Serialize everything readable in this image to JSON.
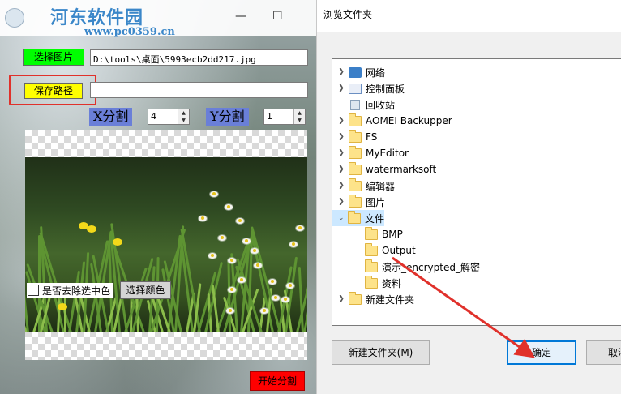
{
  "app": {
    "watermark_logo": "河东软件园",
    "watermark_url": "www.pc0359.cn",
    "select_image_label": "选择图片",
    "image_path": "D:\\tools\\桌面\\5993ecb2dd217.jpg",
    "save_path_label": "保存路径",
    "save_path": "",
    "x_split_label": "X分割",
    "x_split_value": "4",
    "y_split_label": "Y分割",
    "y_split_value": "1",
    "remove_color_label": "是否去除选中色",
    "select_color_label": "选择颜色",
    "start_split_label": "开始分割"
  },
  "dialog": {
    "title": "浏览文件夹",
    "tree": [
      {
        "label": "网络",
        "icon": "network-icon",
        "expander": "right",
        "level": 0
      },
      {
        "label": "控制面板",
        "icon": "control-panel-icon",
        "expander": "right",
        "level": 0
      },
      {
        "label": "回收站",
        "icon": "recycle-bin-icon",
        "expander": "none",
        "level": 0
      },
      {
        "label": "AOMEI Backupper",
        "icon": "folder-icon",
        "expander": "right",
        "level": 0
      },
      {
        "label": "FS",
        "icon": "folder-icon",
        "expander": "right",
        "level": 0
      },
      {
        "label": "MyEditor",
        "icon": "folder-icon",
        "expander": "right",
        "level": 0
      },
      {
        "label": "watermarksoft",
        "icon": "folder-icon",
        "expander": "right",
        "level": 0
      },
      {
        "label": "编辑器",
        "icon": "folder-icon",
        "expander": "right",
        "level": 0
      },
      {
        "label": "图片",
        "icon": "folder-icon",
        "expander": "right",
        "level": 0
      },
      {
        "label": "文件",
        "icon": "folder-icon",
        "expander": "down",
        "level": 0,
        "selected": true
      },
      {
        "label": "BMP",
        "icon": "folder-icon",
        "expander": "none",
        "level": 1
      },
      {
        "label": "Output",
        "icon": "folder-icon",
        "expander": "none",
        "level": 1
      },
      {
        "label": "演示_encrypted_解密",
        "icon": "folder-icon",
        "expander": "none",
        "level": 1
      },
      {
        "label": "资料",
        "icon": "folder-icon",
        "expander": "none",
        "level": 1
      },
      {
        "label": "新建文件夹",
        "icon": "folder-icon",
        "expander": "right",
        "level": 0
      }
    ],
    "new_folder_label": "新建文件夹(M)",
    "ok_label": "确定",
    "cancel_label": "取消"
  },
  "colors": {
    "select_image_button": "#00ff00",
    "save_path_button": "#ffff00",
    "split_label_bg": "#6a7fd8",
    "start_split_button": "#ff0000",
    "highlight_annotation": "#e0312b",
    "selected_row": "#cce8ff"
  }
}
